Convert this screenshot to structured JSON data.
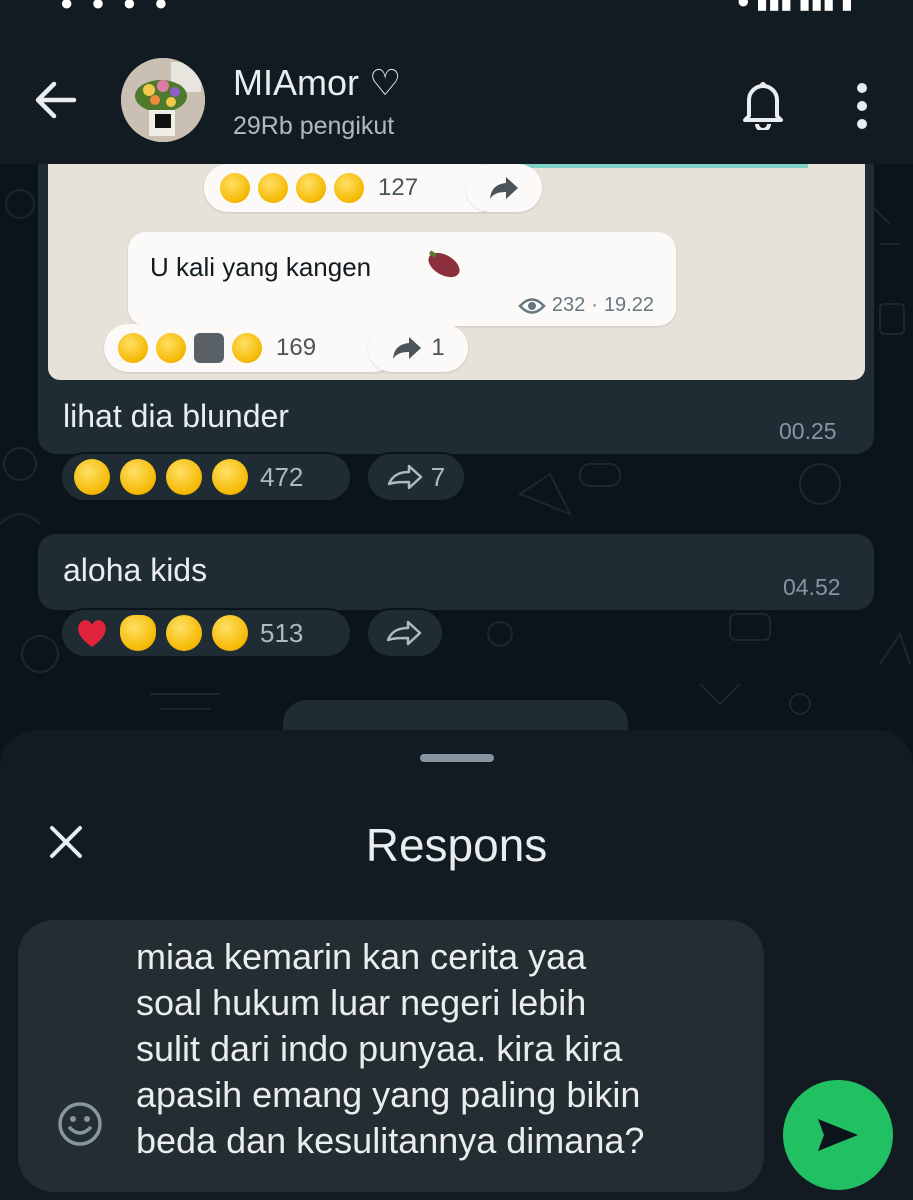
{
  "header": {
    "channel_name": "MIAmor ♡",
    "followers": "29Rb pengikut"
  },
  "chat": {
    "shared_image": {
      "top_reactions": {
        "count": "127"
      },
      "inner_message": {
        "text": "U kali yang kangen",
        "views": "232",
        "time": "19.22"
      },
      "inner_reactions": {
        "count": "169",
        "forwards": "1"
      }
    },
    "messages": [
      {
        "text": "lihat dia blunder",
        "time": "00.25",
        "reaction_count": "472",
        "forward_count": "7"
      },
      {
        "text": "aloha kids",
        "time": "04.52",
        "reaction_count": "513",
        "forward_count": ""
      }
    ]
  },
  "sheet": {
    "title": "Respons",
    "input_value": "miaa kemarin kan cerita yaa\nsoal hukum luar negeri lebih\nsulit dari indo punyaa. kira kira\napasih emang yang paling bikin\nbeda dan kesulitannya dimana?"
  },
  "colors": {
    "background": "#0b141a",
    "bubble": "#1f2c34",
    "accent": "#21c063"
  }
}
